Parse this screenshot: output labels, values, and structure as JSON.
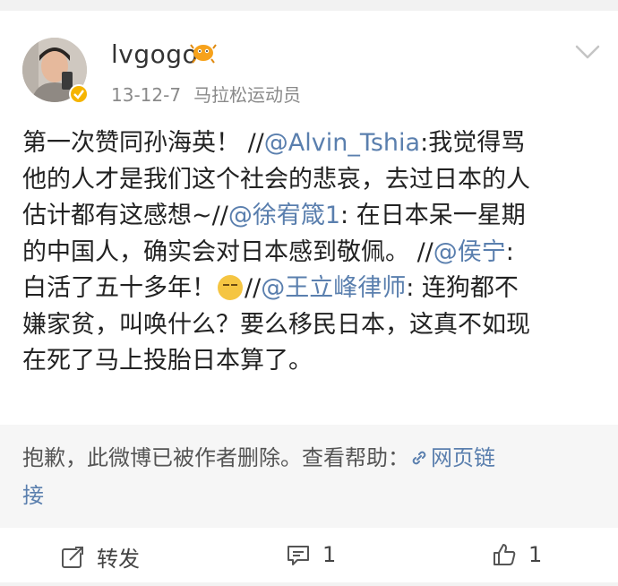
{
  "user": {
    "name": "lvgogo",
    "date": "13-12-7",
    "source": "马拉松运动员"
  },
  "post": {
    "lines": [
      [
        {
          "t": "第一次赞同孙海英！ //"
        },
        {
          "t": "@Alvin_Tshia",
          "m": true
        },
        {
          "t": ":我觉得骂"
        }
      ],
      [
        {
          "t": "他的人才是我们这个社会的悲哀，去过日本的人"
        }
      ],
      [
        {
          "t": "估计都有这感想~//"
        },
        {
          "t": "@徐宥箴1",
          "m": true
        },
        {
          "t": ": 在日本呆一星期"
        }
      ],
      [
        {
          "t": "的中国人，确实会对日本感到敬佩。 //"
        },
        {
          "t": "@侯宁",
          "m": true
        },
        {
          "t": ":"
        }
      ],
      [
        {
          "t": "白活了五十多年！"
        },
        {
          "emoji": "sleepy-face-emoji"
        },
        {
          "t": "//"
        },
        {
          "t": "@王立峰律师",
          "m": true
        },
        {
          "t": ": 连狗都不"
        }
      ],
      [
        {
          "t": "嫌家贫，叫唤什么？要么移民日本，这真不如现"
        }
      ],
      [
        {
          "t": "在死了马上投胎日本算了。"
        }
      ]
    ]
  },
  "deleted_notice": {
    "text": "抱歉，此微博已被作者删除。查看帮助：",
    "link_line1": "网页链",
    "link_line2": "接"
  },
  "actions": {
    "repost_label": "转发",
    "comment_count": "1",
    "like_count": "1"
  },
  "colors": {
    "link": "#5a7fae",
    "verified": "#f5b400"
  }
}
